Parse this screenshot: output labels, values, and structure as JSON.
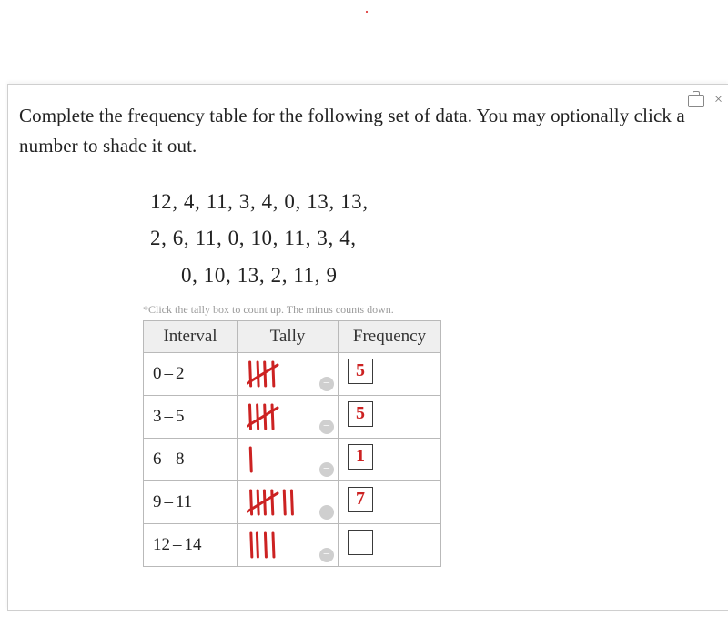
{
  "prompt_line1": "Complete the frequency table for the following set of data. You may optionally click a",
  "prompt_line2": "number to shade it out.",
  "dataset_rows": [
    "12,  4,  11,  3,  4,  0,  13,  13,",
    "2,  6,  11,  0,  10,  11,  3,  4,",
    "0,  10,  13,  2,  11,  9"
  ],
  "hint": "*Click the tally box to count up. The minus counts down.",
  "headers": {
    "interval": "Interval",
    "tally": "Tally",
    "frequency": "Frequency"
  },
  "rows": [
    {
      "lo": "0",
      "hi": "2",
      "tally_count": 5,
      "freq_handwritten": "5"
    },
    {
      "lo": "3",
      "hi": "5",
      "tally_count": 5,
      "freq_handwritten": "5"
    },
    {
      "lo": "6",
      "hi": "8",
      "tally_count": 1,
      "freq_handwritten": "1"
    },
    {
      "lo": "9",
      "hi": "11",
      "tally_count": 7,
      "freq_handwritten": "7"
    },
    {
      "lo": "12",
      "hi": "14",
      "tally_count": 4,
      "freq_handwritten": ""
    }
  ],
  "close_glyph": "×",
  "minus_glyph": "−",
  "tally_color": "#c22"
}
